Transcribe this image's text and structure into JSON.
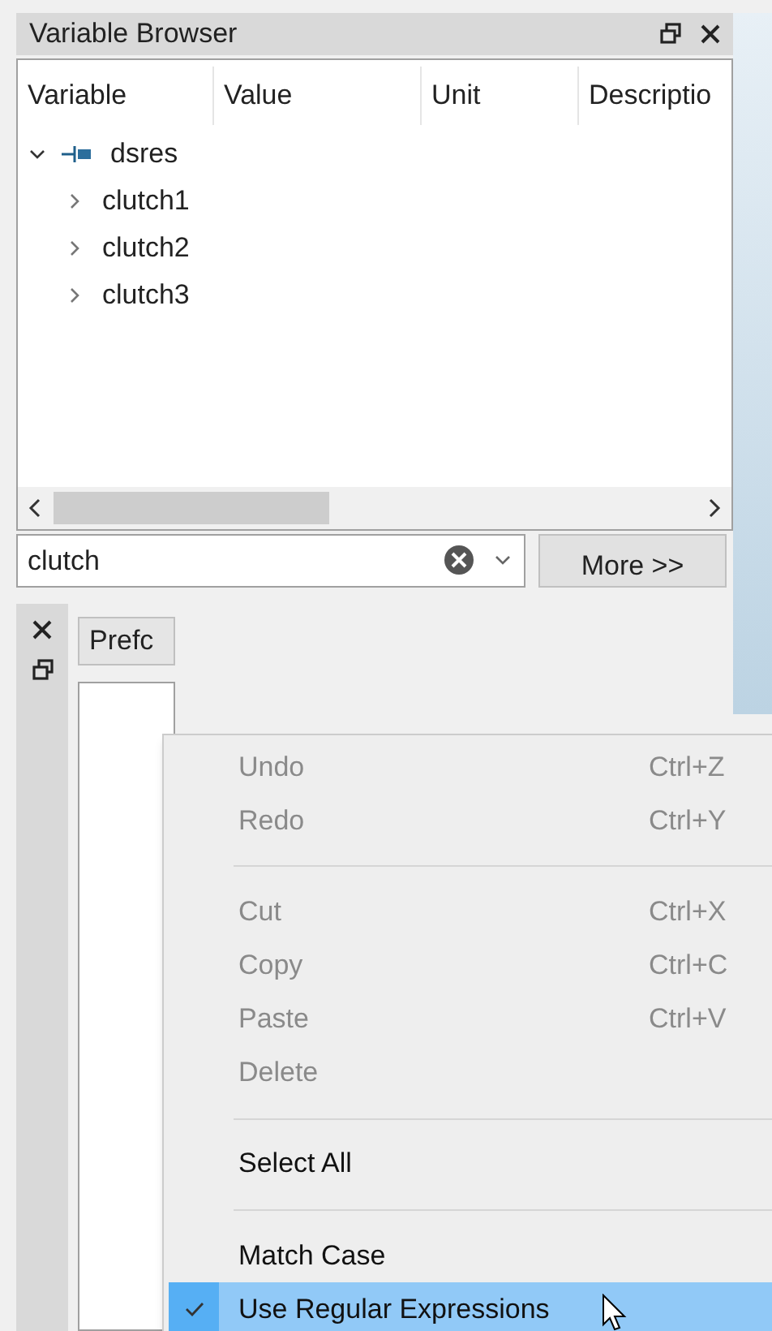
{
  "panel": {
    "title": "Variable Browser"
  },
  "table": {
    "columns": [
      "Variable",
      "Value",
      "Unit",
      "Descriptio"
    ],
    "rows": [
      {
        "label": "dsres",
        "expanded": true,
        "children": [
          {
            "label": "clutch1",
            "expanded": false
          },
          {
            "label": "clutch2",
            "expanded": false
          },
          {
            "label": "clutch3",
            "expanded": false
          }
        ]
      }
    ]
  },
  "search": {
    "value": "clutch"
  },
  "more_button": "More >>",
  "lower_panel": {
    "tab": "Prefc"
  },
  "context_menu": [
    {
      "kind": "action",
      "label": "Undo",
      "shortcut": "Ctrl+Z",
      "disabled": true,
      "checked": false,
      "selected": false
    },
    {
      "kind": "action",
      "label": "Redo",
      "shortcut": "Ctrl+Y",
      "disabled": true,
      "checked": false,
      "selected": false
    },
    {
      "kind": "separator"
    },
    {
      "kind": "action",
      "label": "Cut",
      "shortcut": "Ctrl+X",
      "disabled": true,
      "checked": false,
      "selected": false
    },
    {
      "kind": "action",
      "label": "Copy",
      "shortcut": "Ctrl+C",
      "disabled": true,
      "checked": false,
      "selected": false
    },
    {
      "kind": "action",
      "label": "Paste",
      "shortcut": "Ctrl+V",
      "disabled": true,
      "checked": false,
      "selected": false
    },
    {
      "kind": "action",
      "label": "Delete",
      "disabled": true,
      "checked": false,
      "selected": false
    },
    {
      "kind": "separator"
    },
    {
      "kind": "action",
      "label": "Select All",
      "disabled": false,
      "checked": false,
      "selected": false
    },
    {
      "kind": "separator"
    },
    {
      "kind": "action",
      "label": "Match Case",
      "disabled": false,
      "checked": false,
      "selected": false
    },
    {
      "kind": "action",
      "label": "Use Regular Expressions",
      "disabled": false,
      "checked": true,
      "selected": true
    }
  ]
}
